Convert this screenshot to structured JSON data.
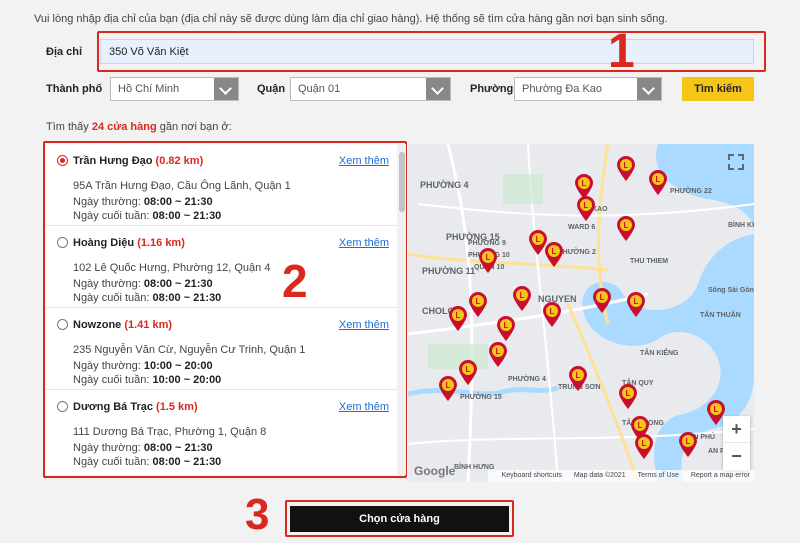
{
  "intro": "Vui lòng nhập địa chỉ của bạn (địa chỉ này sẽ được dùng làm địa chỉ giao hàng). Hệ thống sẽ tìm cửa hàng gần nơi bạn sinh sống.",
  "address": {
    "label": "Địa chỉ",
    "value": "350 Võ Văn Kiệt"
  },
  "filters": {
    "city": {
      "label": "Thành phố",
      "value": "Hồ Chí Minh"
    },
    "district": {
      "label": "Quận",
      "value": "Quận 01"
    },
    "ward": {
      "label": "Phường",
      "value": "Phường Đa Kao"
    }
  },
  "search_label": "Tìm kiếm",
  "found": {
    "prefix": "Tìm thấy ",
    "count": "24 cửa hàng",
    "suffix": " gần nơi bạn ở:"
  },
  "more_label": "Xem thêm",
  "weekday_label": "Ngày thường:",
  "weekend_label": "Ngày cuối tuần:",
  "stores": [
    {
      "name": "Trần Hưng Đạo",
      "distance": "(0.82 km)",
      "address": "95A Trần Hưng Đạo, Cầu Ông Lãnh, Quận 1",
      "weekday": "08:00 ~ 21:30",
      "weekend": "08:00 ~ 21:30",
      "selected": true
    },
    {
      "name": "Hoàng Diệu",
      "distance": "(1.16 km)",
      "address": "102 Lê Quốc Hưng, Phường 12, Quận 4",
      "weekday": "08:00 ~ 21:30",
      "weekend": "08:00 ~ 21:30",
      "selected": false
    },
    {
      "name": "Nowzone",
      "distance": "(1.41 km)",
      "address": "235 Nguyễn Văn Cừ, Nguyễn Cư Trinh, Quận 1",
      "weekday": "10:00 ~ 20:00",
      "weekend": "10:00 ~ 20:00",
      "selected": false
    },
    {
      "name": "Dương Bá Trạc",
      "distance": "(1.5 km)",
      "address": "111 Dương Bá Trạc, Phường 1, Quận 8",
      "weekday": "08:00 ~ 21:30",
      "weekend": "08:00 ~ 21:30",
      "selected": false
    }
  ],
  "map": {
    "labels": [
      "PHƯỜNG 4",
      "PHƯỜNG 15",
      "PHƯỜNG 11",
      "NGUYEN",
      "CHOLON",
      "PHƯỜNG 15",
      "PHƯỜNG 4",
      "BÌNH HƯNG",
      "TÂN KIỂNG",
      "TÂN QUY",
      "TÂN PHONG",
      "THU THIEM",
      "BÌNH KHÁN",
      "AN PHÚ",
      "TÂN THUẬN",
      "TÂN PHÚ",
      "KAO",
      "WARD 6",
      "PHƯỜNG 22",
      "PHƯỜNG 2",
      "Sông Sài Gòn",
      "TRUNG SƠN",
      "PHƯỜNG 10",
      "QUẬN 10",
      "PHƯỜNG 9"
    ],
    "google": "Google",
    "footer": [
      "Keyboard shortcuts",
      "Map data ©2021",
      "Terms of Use",
      "Report a map error"
    ],
    "zoom_in": "+",
    "zoom_out": "−",
    "brand_letter": "L",
    "brand_color": "#c8102e"
  },
  "step_badges": [
    "1",
    "2",
    "3"
  ],
  "choose_label": "Chọn cửa hàng",
  "colors": {
    "accent": "#d9281e",
    "button_yellow": "#f5c518",
    "link": "#1a6fd6"
  }
}
